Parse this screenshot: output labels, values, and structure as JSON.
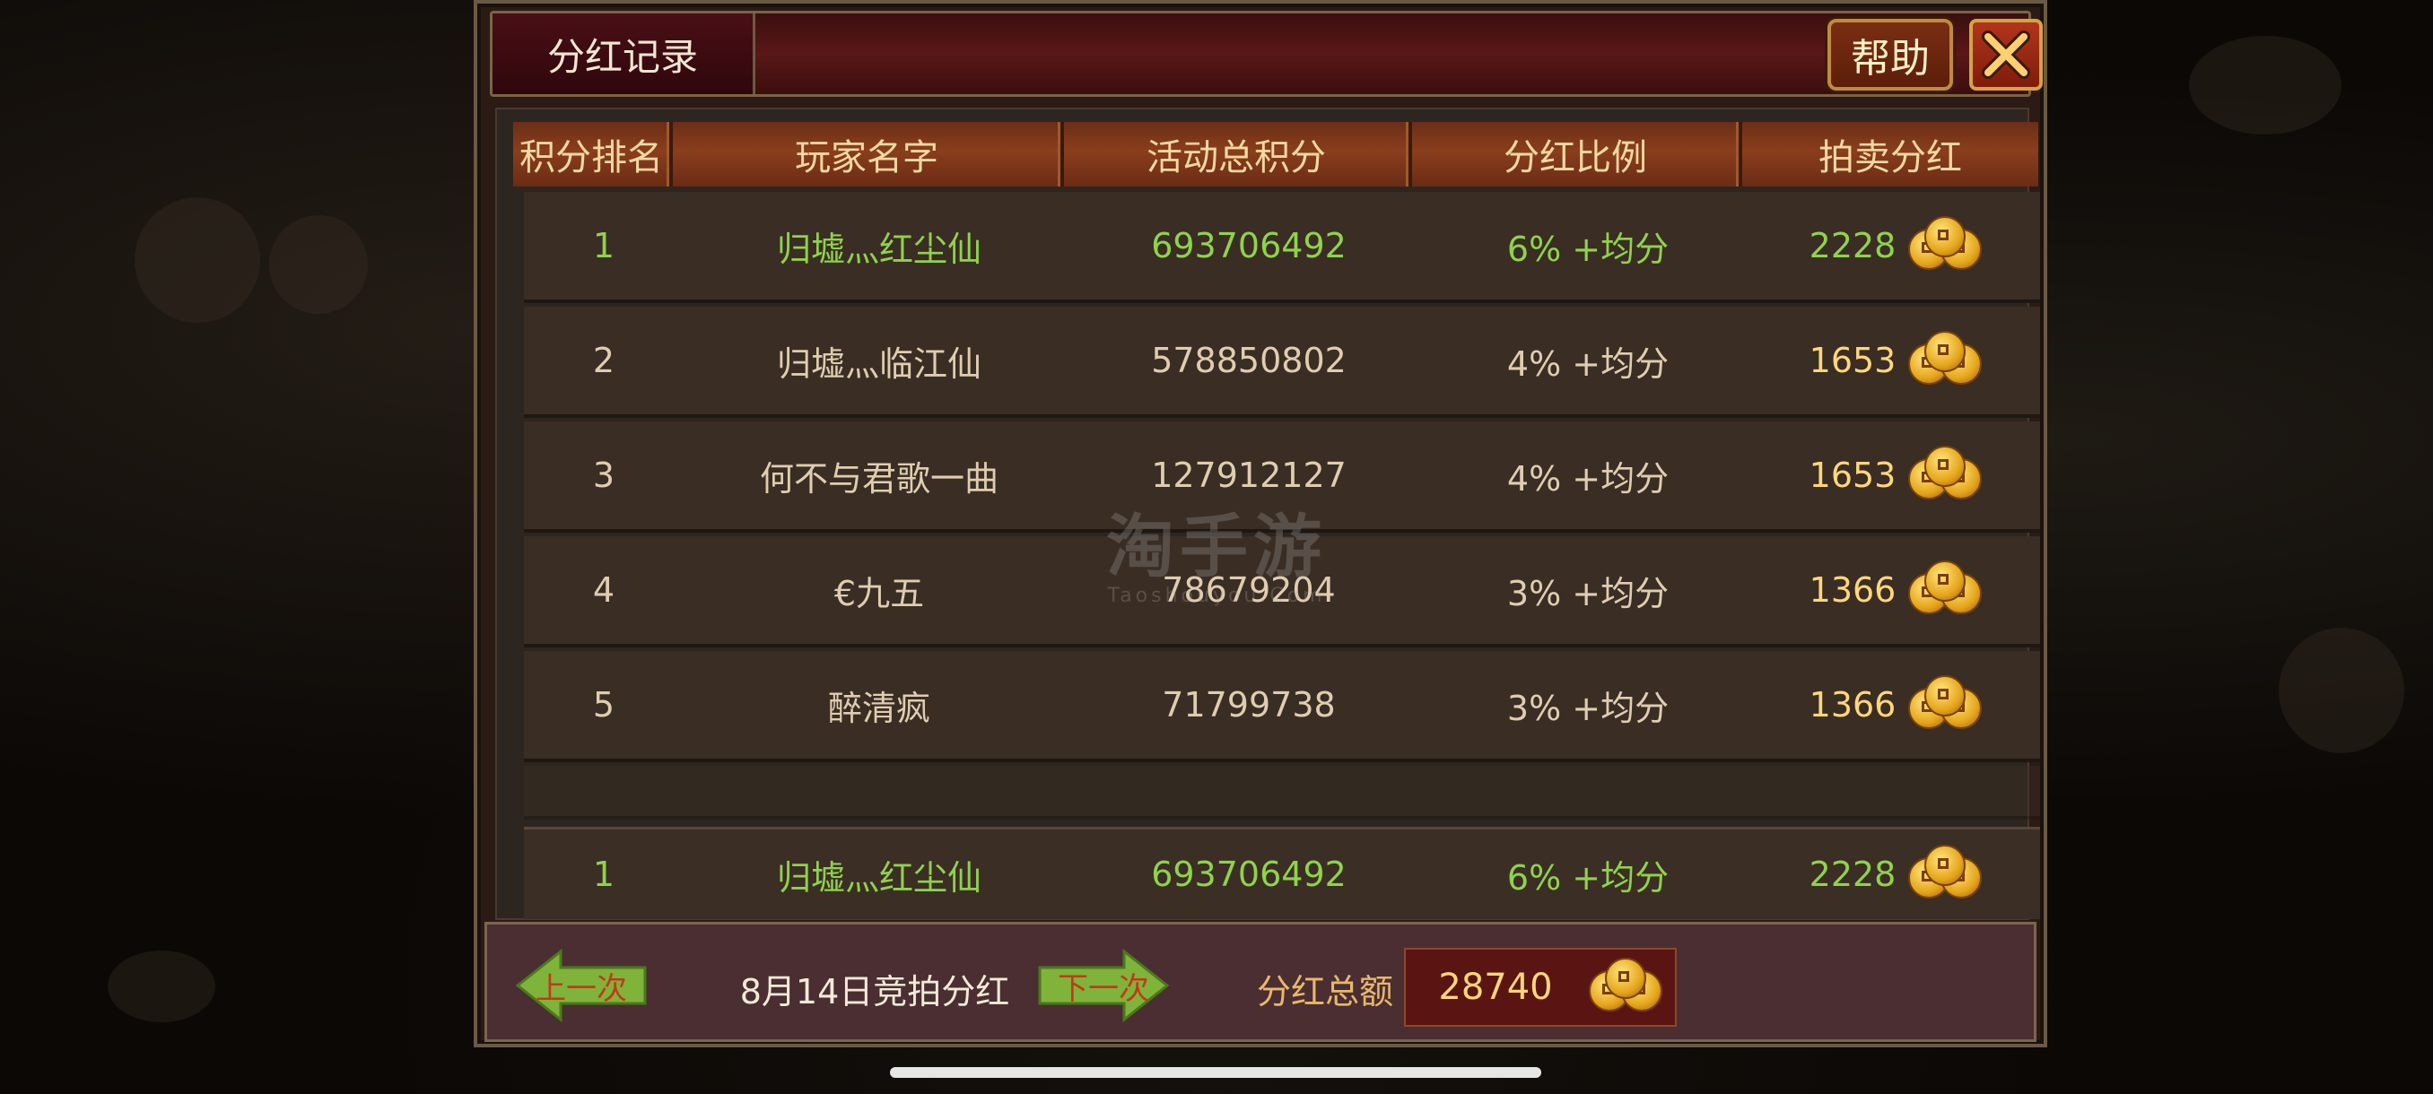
{
  "dialog": {
    "title": "分红记录",
    "help_label": "帮助",
    "close_icon": "close-icon"
  },
  "table": {
    "headers": [
      "积分排名",
      "玩家名字",
      "活动总积分",
      "分红比例",
      "拍卖分红"
    ],
    "rows": [
      {
        "rank": "1",
        "name": "归墟灬红尘仙",
        "score": "693706492",
        "ratio": "6% +均分",
        "dividend": "2228",
        "highlight": true
      },
      {
        "rank": "2",
        "name": "归墟灬临江仙",
        "score": "578850802",
        "ratio": "4% +均分",
        "dividend": "1653",
        "highlight": false
      },
      {
        "rank": "3",
        "name": "何不与君歌一曲",
        "score": "127912127",
        "ratio": "4% +均分",
        "dividend": "1653",
        "highlight": false
      },
      {
        "rank": "4",
        "name": "€九五",
        "score": "78679204",
        "ratio": "3% +均分",
        "dividend": "1366",
        "highlight": false
      },
      {
        "rank": "5",
        "name": "醉清疯",
        "score": "71799738",
        "ratio": "3% +均分",
        "dividend": "1366",
        "highlight": false
      }
    ],
    "my_row": {
      "rank": "1",
      "name": "归墟灬红尘仙",
      "score": "693706492",
      "ratio": "6% +均分",
      "dividend": "2228"
    }
  },
  "watermark": {
    "main": "淘手游",
    "sub": "Taoshouyou.Com"
  },
  "footer": {
    "prev_label": "上一次",
    "next_label": "下一次",
    "date_label": "8月14日竞拍分红",
    "total_label": "分红总额",
    "total_value": "28740"
  },
  "colors": {
    "highlight_green": "#8fd34a",
    "normal_text": "#e0cdb0",
    "gold": "#ffd77a"
  }
}
